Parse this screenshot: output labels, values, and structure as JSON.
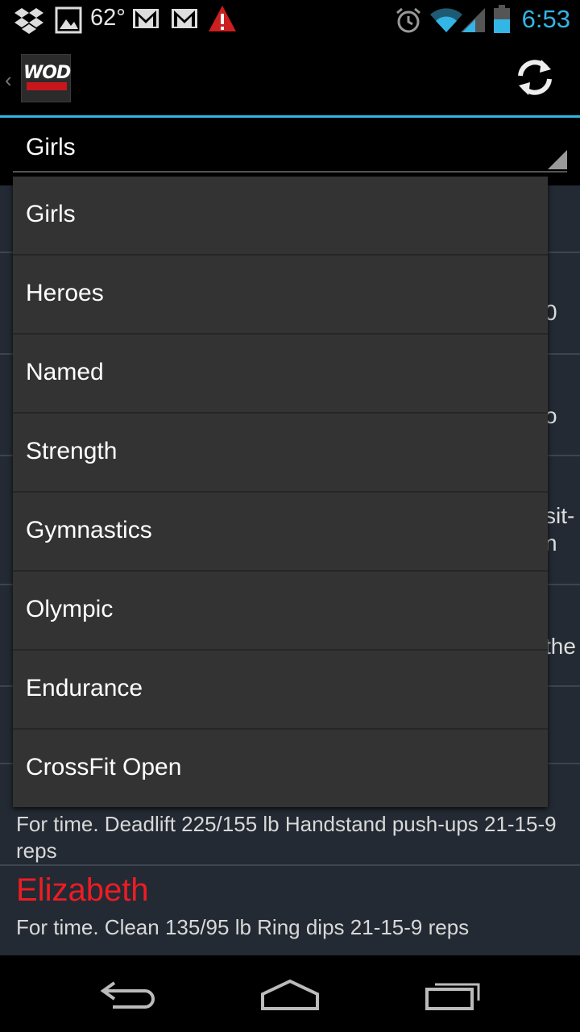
{
  "status_bar": {
    "temperature": "62°",
    "time": "6:53",
    "icons": [
      "dropbox-icon",
      "gallery-icon",
      "gmail-icon",
      "gmail-icon",
      "warning-icon",
      "alarm-icon",
      "wifi-icon",
      "signal-icon",
      "battery-icon"
    ]
  },
  "action_bar": {
    "app_name": "WOD",
    "refresh_icon": "refresh-icon"
  },
  "spinner": {
    "selected": "Girls"
  },
  "dropdown": {
    "options": [
      "Girls",
      "Heroes",
      "Named",
      "Strength",
      "Gymnastics",
      "Olympic",
      "Endurance",
      "CrossFit Open"
    ]
  },
  "background_peek": {
    "row2_text": "0",
    "row3_text": "o",
    "row4_line1": "sit-",
    "row4_line2": "n",
    "row5_text": "the"
  },
  "wods": [
    {
      "name": "",
      "description": "For time. Deadlift 225/155 lb Handstand push-ups 21-15-9 reps"
    },
    {
      "name": "Elizabeth",
      "description": "For time. Clean 135/95 lb Ring dips 21-15-9 reps"
    }
  ],
  "colors": {
    "accent": "#33b5e5",
    "wod_name": "#ee1c24"
  }
}
